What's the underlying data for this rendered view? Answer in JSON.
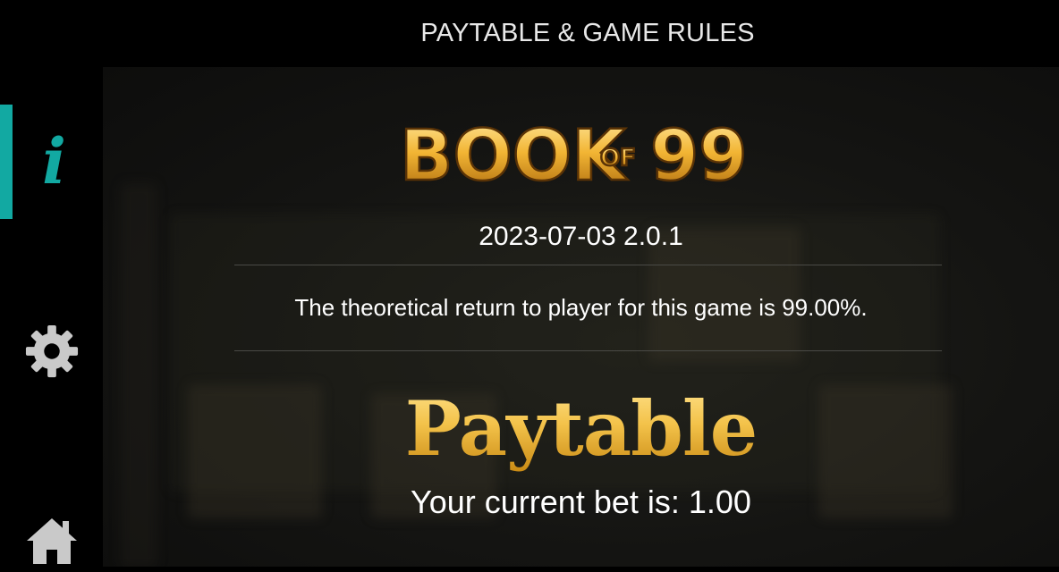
{
  "header": {
    "title": "PAYTABLE & GAME RULES"
  },
  "sidebar": {
    "items": [
      {
        "name": "info",
        "icon": "info-icon",
        "glyph": "i",
        "active": true
      },
      {
        "name": "settings",
        "icon": "gear-icon",
        "active": false
      },
      {
        "name": "home",
        "icon": "home-icon",
        "active": false
      }
    ]
  },
  "game": {
    "logo_text": "BOOK OF 99",
    "logo_parts": {
      "word1": "BOOK",
      "word2": "OF",
      "word3": "99"
    },
    "version": "2023-07-03 2.0.1",
    "rtp_text": "The theoretical return to player for this game is 99.00%."
  },
  "paytable": {
    "title": "Paytable",
    "bet_text": "Your current bet is: 1.00"
  },
  "colors": {
    "accent": "#12a9a2",
    "gold": "#f0b937",
    "icon": "#c9c9c9",
    "background": "#000000"
  }
}
